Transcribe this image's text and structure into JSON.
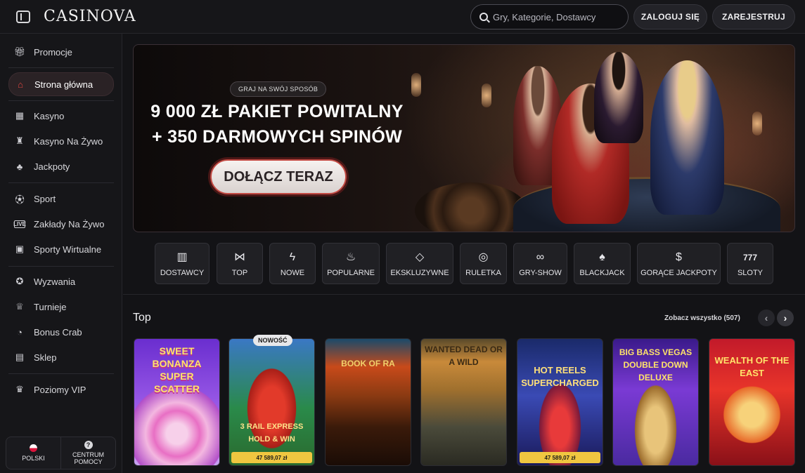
{
  "header": {
    "logo": "CASINOVA",
    "search_placeholder": "Gry, Kategorie, Dostawcy",
    "login_label": "ZALOGUJ SIĘ",
    "register_label": "ZAREJESTRUJ"
  },
  "sidebar": {
    "items": [
      {
        "label": "Promocje",
        "icon": "gift-icon",
        "active": false
      },
      {
        "label": "Strona główna",
        "icon": "home-icon",
        "active": true
      },
      {
        "label": "Kasyno",
        "icon": "slot-machine-icon",
        "active": false
      },
      {
        "label": "Kasyno Na Żywo",
        "icon": "live-dealer-icon",
        "active": false
      },
      {
        "label": "Jackpoty",
        "icon": "clover-icon",
        "active": false
      },
      {
        "label": "Sport",
        "icon": "soccer-ball-icon",
        "active": false
      },
      {
        "label": "Zakłady Na Żywo",
        "icon": "live-bet-icon",
        "active": false
      },
      {
        "label": "Sporty Wirtualne",
        "icon": "virtual-sport-icon",
        "active": false
      },
      {
        "label": "Wyzwania",
        "icon": "medal-icon",
        "active": false
      },
      {
        "label": "Turnieje",
        "icon": "trophy-icon",
        "active": false
      },
      {
        "label": "Bonus Crab",
        "icon": "claw-icon",
        "active": false
      },
      {
        "label": "Sklep",
        "icon": "shop-icon",
        "active": false
      },
      {
        "label": "Poziomy VIP",
        "icon": "crown-icon",
        "active": false
      }
    ],
    "language_label": "POLSKI",
    "help_label_line1": "CENTRUM",
    "help_label_line2": "POMOCY"
  },
  "hero": {
    "tag": "GRAJ NA SWÓJ SPOSÓB",
    "title_line1": "9 000 ZŁ PAKIET POWITALNY",
    "title_line2": "+ 350 DARMOWYCH SPINÓW",
    "cta_label": "DOŁĄCZ TERAZ"
  },
  "categories": [
    {
      "label": "DOSTAWCY",
      "icon": "provider-card-icon"
    },
    {
      "label": "TOP",
      "icon": "bow-tie-icon"
    },
    {
      "label": "NOWE",
      "icon": "lightning-icon"
    },
    {
      "label": "POPULARNE",
      "icon": "flame-icon"
    },
    {
      "label": "EKSKLUZYWNE",
      "icon": "diamond-icon"
    },
    {
      "label": "RULETKA",
      "icon": "roulette-icon"
    },
    {
      "label": "GRY-SHOW",
      "icon": "mask-icon"
    },
    {
      "label": "BLACKJACK",
      "icon": "cards-icon"
    },
    {
      "label": "GORĄCE JACKPOTY",
      "icon": "money-bag-icon"
    },
    {
      "label": "SLOTY",
      "icon": "slot-777-icon"
    }
  ],
  "games_section": {
    "title": "Top",
    "see_all": "Zobacz wszystko (507)",
    "games": [
      {
        "title": "SWEET BONANZA SUPER SCATTER",
        "badge": "",
        "jackpot": ""
      },
      {
        "title": "3 RAIL EXPRESS HOLD & WIN",
        "badge": "NOWOŚĆ",
        "jackpot": "47 589,07 zł"
      },
      {
        "title": "BOOK OF RA",
        "badge": "",
        "jackpot": ""
      },
      {
        "title": "WANTED DEAD OR A WILD",
        "badge": "",
        "jackpot": ""
      },
      {
        "title": "HOT REELS SUPERCHARGED",
        "badge": "",
        "jackpot": "47 589,07 zł"
      },
      {
        "title": "BIG BASS VEGAS DOUBLE DOWN DELUXE",
        "badge": "",
        "jackpot": ""
      },
      {
        "title": "WEALTH OF THE EAST",
        "badge": "",
        "jackpot": ""
      }
    ]
  },
  "colors": {
    "background": "#131316",
    "accent_red": "#e2463f",
    "jackpot_yellow": "#f0c640"
  }
}
